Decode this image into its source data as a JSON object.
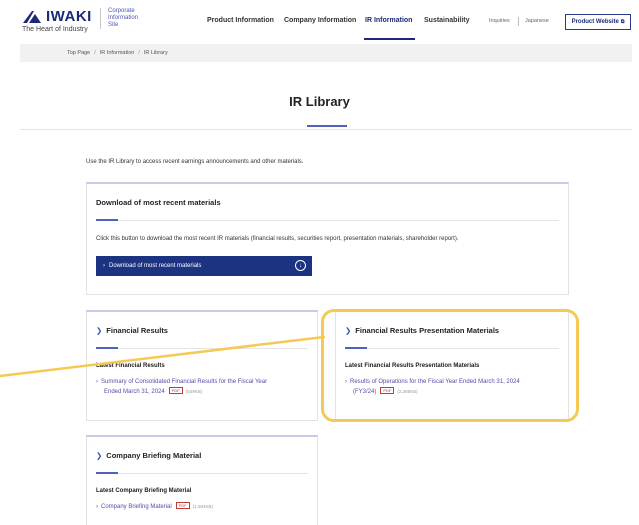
{
  "header": {
    "logo_text": "IWAKI",
    "tagline": "The Heart of Industry",
    "site_label_lines": [
      "Corporate",
      "Information",
      "Site"
    ],
    "nav": [
      "Product Information",
      "Company Information",
      "IR Information",
      "Sustainability"
    ],
    "active_nav": "IR Information",
    "utility_links": [
      "Inquiries",
      "Japanese"
    ],
    "product_button": "Product Website",
    "accent_color": "#1b2a78"
  },
  "breadcrumb": [
    "Top Page",
    "IR Information",
    "IR Library"
  ],
  "page": {
    "title": "IR Library",
    "intro": "Use the IR Library to access recent earnings announcements and other materials."
  },
  "download_card": {
    "title": "Download of most recent materials",
    "description": "Click this button to download the most recent IR materials (financial results, securities report, presentation materials, shareholder report).",
    "button_label": "Download of most recent materials",
    "button_icon": "download-icon"
  },
  "financial_results": {
    "title": "Financial Results",
    "sub_heading": "Latest Financial Results",
    "link_lines": [
      "Summary of Consolidated Financial Results for the Fiscal Year",
      "Ended March 31, 2024"
    ],
    "badge": "PDF",
    "size": "(549KB)"
  },
  "presentation": {
    "title": "Financial Results Presentation Materials",
    "sub_heading": "Latest Financial Results Presentation Materials",
    "link_lines": [
      "Results of Operations for the Fiscal Year Ended March 31, 2024",
      "(FY3/24)"
    ],
    "badge": "PDF",
    "size": "(2,285KB)"
  },
  "briefing": {
    "title": "Company Briefing Material",
    "sub_heading": "Latest Company Briefing Material",
    "link_text": "Company Briefing Material",
    "badge": "PDF",
    "size": "(1,984KB)"
  },
  "highlight_color": "#f4ca55"
}
